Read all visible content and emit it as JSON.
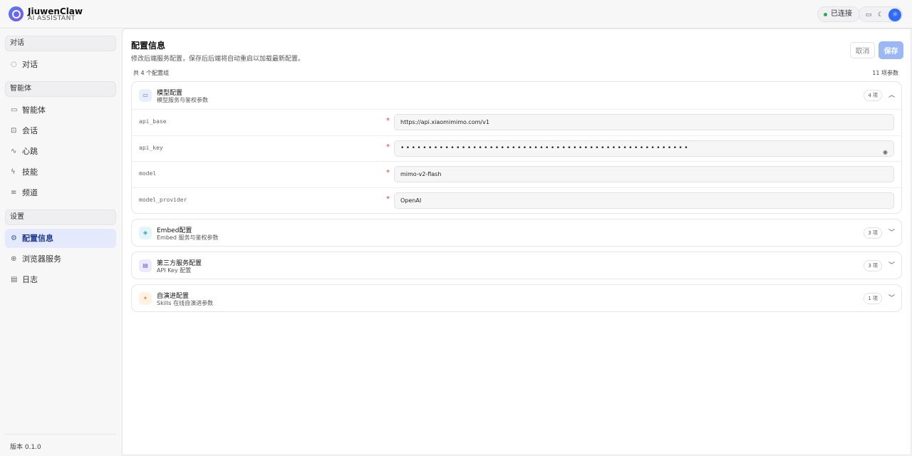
{
  "app": {
    "name": "JiuwenClaw",
    "subtitle": "AI ASSISTANT"
  },
  "header": {
    "status": "已连接",
    "theme_icons": [
      "monitor-icon",
      "moon-icon",
      "sun-icon"
    ],
    "active_theme": "sun-icon"
  },
  "sidebar": {
    "sections": [
      {
        "title": "对话",
        "items": [
          {
            "label": "对话",
            "icon": "chat-icon"
          }
        ]
      },
      {
        "title": "智能体",
        "items": [
          {
            "label": "智能体",
            "icon": "monitor-icon"
          },
          {
            "label": "会话",
            "icon": "scan-icon"
          },
          {
            "label": "心跳",
            "icon": "pulse-icon"
          },
          {
            "label": "技能",
            "icon": "bolt-icon"
          },
          {
            "label": "频道",
            "icon": "list-icon"
          }
        ]
      },
      {
        "title": "设置",
        "items": [
          {
            "label": "配置信息",
            "icon": "gear-icon",
            "active": true
          },
          {
            "label": "浏览器服务",
            "icon": "globe-icon"
          },
          {
            "label": "日志",
            "icon": "document-icon"
          }
        ]
      }
    ],
    "version": "版本 0.1.0"
  },
  "page": {
    "title": "配置信息",
    "description": "修改后端服务配置，保存后后端将自动重启以加载最新配置。",
    "cancel_label": "取消",
    "save_label": "保存",
    "group_count": "共 4 个配置组",
    "param_count": "11 项参数"
  },
  "groups": [
    {
      "title": "模型配置",
      "subtitle": "模型服务与鉴权参数",
      "count": "4 项",
      "expanded": true,
      "icon": "box-icon",
      "fields": [
        {
          "name": "api_base",
          "value": "https://api.xiaomimimo.com/v1"
        },
        {
          "name": "api_key",
          "value": "••••••••••••••••••••••••••••••••••••••••••••••••••••",
          "masked": true
        },
        {
          "name": "model",
          "value": "mimo-v2-flash"
        },
        {
          "name": "model_provider",
          "value": "OpenAI"
        }
      ]
    },
    {
      "title": "Embed配置",
      "subtitle": "Embed 服务与鉴权参数",
      "count": "3 项",
      "expanded": false,
      "icon": "cube-icon"
    },
    {
      "title": "第三方服务配置",
      "subtitle": "API Key 配置",
      "count": "3 项",
      "expanded": false,
      "icon": "card-icon"
    },
    {
      "title": "自演进配置",
      "subtitle": "Skills 在线自演进参数",
      "count": "1 项",
      "expanded": false,
      "icon": "sparkle-icon"
    }
  ],
  "colors": {
    "accent": "#2f6bff",
    "save_disabled": "#9ab8f8",
    "required": "#e03b3b",
    "status_ok": "#22b04b"
  }
}
